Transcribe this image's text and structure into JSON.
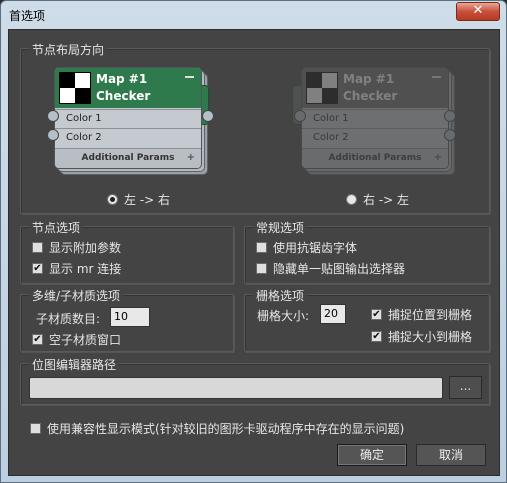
{
  "window": {
    "title": "首选项",
    "close_glyph": "✕"
  },
  "node_layout": {
    "label": "节点布局方向",
    "node": {
      "map_name": "Map #1",
      "map_type": "Checker",
      "slots": [
        "Color 1",
        "Color 2"
      ],
      "footer": "Additional Params",
      "footer_plus": "+",
      "minimize_glyph": "—"
    },
    "left_to_right": {
      "label": "左 -> 右",
      "selected": true
    },
    "right_to_left": {
      "label": "右 -> 左",
      "selected": false
    }
  },
  "node_options": {
    "label": "节点选项",
    "show_extra_params": {
      "label": "显示附加参数",
      "checked": false
    },
    "show_mr_connections": {
      "label": "显示 mr 连接",
      "checked": true
    }
  },
  "general_options": {
    "label": "常规选项",
    "antialiased_font": {
      "label": "使用抗锯齿字体",
      "checked": false
    },
    "hide_output_selector": {
      "label": "隐藏单一贴图输出选择器",
      "checked": false
    }
  },
  "multi_sub": {
    "label": "多维/子材质选项",
    "count_label": "子材质数目:",
    "count_value": "10",
    "empty_window": {
      "label": "空子材质窗口",
      "checked": true
    }
  },
  "grid": {
    "label": "栅格选项",
    "size_label": "栅格大小:",
    "size_value": "20",
    "snap_position": {
      "label": "捕捉位置到栅格",
      "checked": true
    },
    "snap_size": {
      "label": "捕捉大小到栅格",
      "checked": true
    }
  },
  "bitmap_path": {
    "label": "位图编辑器路径",
    "value": "",
    "browse_label": "..."
  },
  "compat_mode": {
    "label": "使用兼容性显示模式(针对较旧的图形卡驱动程序中存在的显示问题)",
    "checked": false
  },
  "buttons": {
    "ok": "确定",
    "cancel": "取消"
  },
  "colors": {
    "node_header": "#2e7a4c",
    "panel_bg": "#444444",
    "close_button": "#c8503a"
  },
  "check_glyph": "✔"
}
